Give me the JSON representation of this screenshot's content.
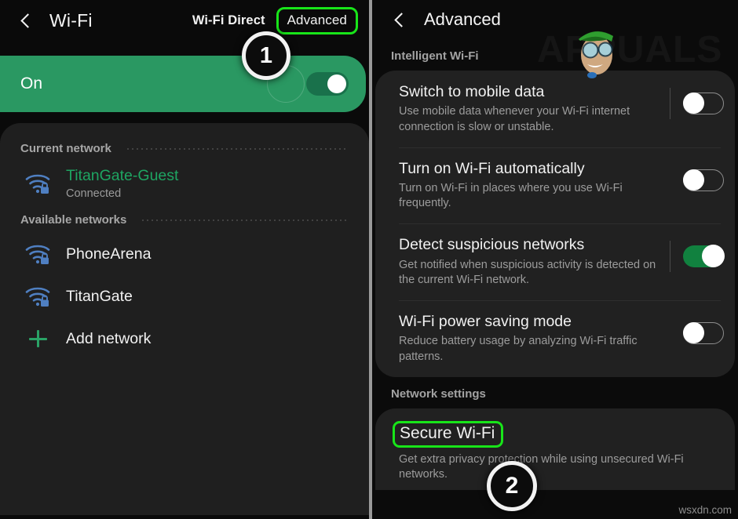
{
  "left": {
    "back_icon": "back-chevron-icon",
    "title": "Wi-Fi",
    "wifi_direct_label": "Wi-Fi Direct",
    "advanced_label": "Advanced",
    "wifi_state_label": "On",
    "wifi_toggle_state": "on",
    "sections": [
      {
        "header": "Current network",
        "rows": [
          {
            "icon": "wifi-lock-icon",
            "name": "TitanGate-Guest",
            "status": "Connected",
            "highlighted": true
          }
        ]
      },
      {
        "header": "Available networks",
        "rows": [
          {
            "icon": "wifi-lock-icon",
            "name": "PhoneArena",
            "status": "",
            "highlighted": false
          },
          {
            "icon": "wifi-lock-icon",
            "name": "TitanGate",
            "status": "",
            "highlighted": false
          },
          {
            "icon": "plus-icon",
            "name": "Add network",
            "status": "",
            "highlighted": false
          }
        ]
      }
    ]
  },
  "right": {
    "back_icon": "back-chevron-icon",
    "title": "Advanced",
    "group_1_label": "Intelligent Wi-Fi",
    "group_2_label": "Network settings",
    "settings": [
      {
        "title": "Switch to mobile data",
        "desc": "Use mobile data whenever your Wi-Fi internet connection is slow or unstable.",
        "toggle": "off"
      },
      {
        "title": "Turn on Wi-Fi automatically",
        "desc": "Turn on Wi-Fi in places where you use Wi-Fi frequently.",
        "toggle": "off"
      },
      {
        "title": "Detect suspicious networks",
        "desc": "Get notified when suspicious activity is detected on the current Wi-Fi network.",
        "toggle": "on"
      },
      {
        "title": "Wi-Fi power saving mode",
        "desc": "Reduce battery usage by analyzing Wi-Fi traffic patterns.",
        "toggle": "off"
      }
    ],
    "secure_wifi": {
      "title": "Secure Wi-Fi",
      "desc": "Get extra privacy protection while using unsecured Wi-Fi networks."
    }
  },
  "annotations": {
    "badge_1": "1",
    "badge_2": "2"
  },
  "watermarks": {
    "appuals": "APPUALS",
    "source": "wsxdn.com"
  },
  "colors": {
    "accent_green": "#2a9862",
    "highlight_green": "#18e519",
    "toggle_on_green": "#11813f",
    "wifi_icon_blue": "#4f7fc1",
    "card_bg": "#212121",
    "page_bg": "#0a0a0a"
  }
}
